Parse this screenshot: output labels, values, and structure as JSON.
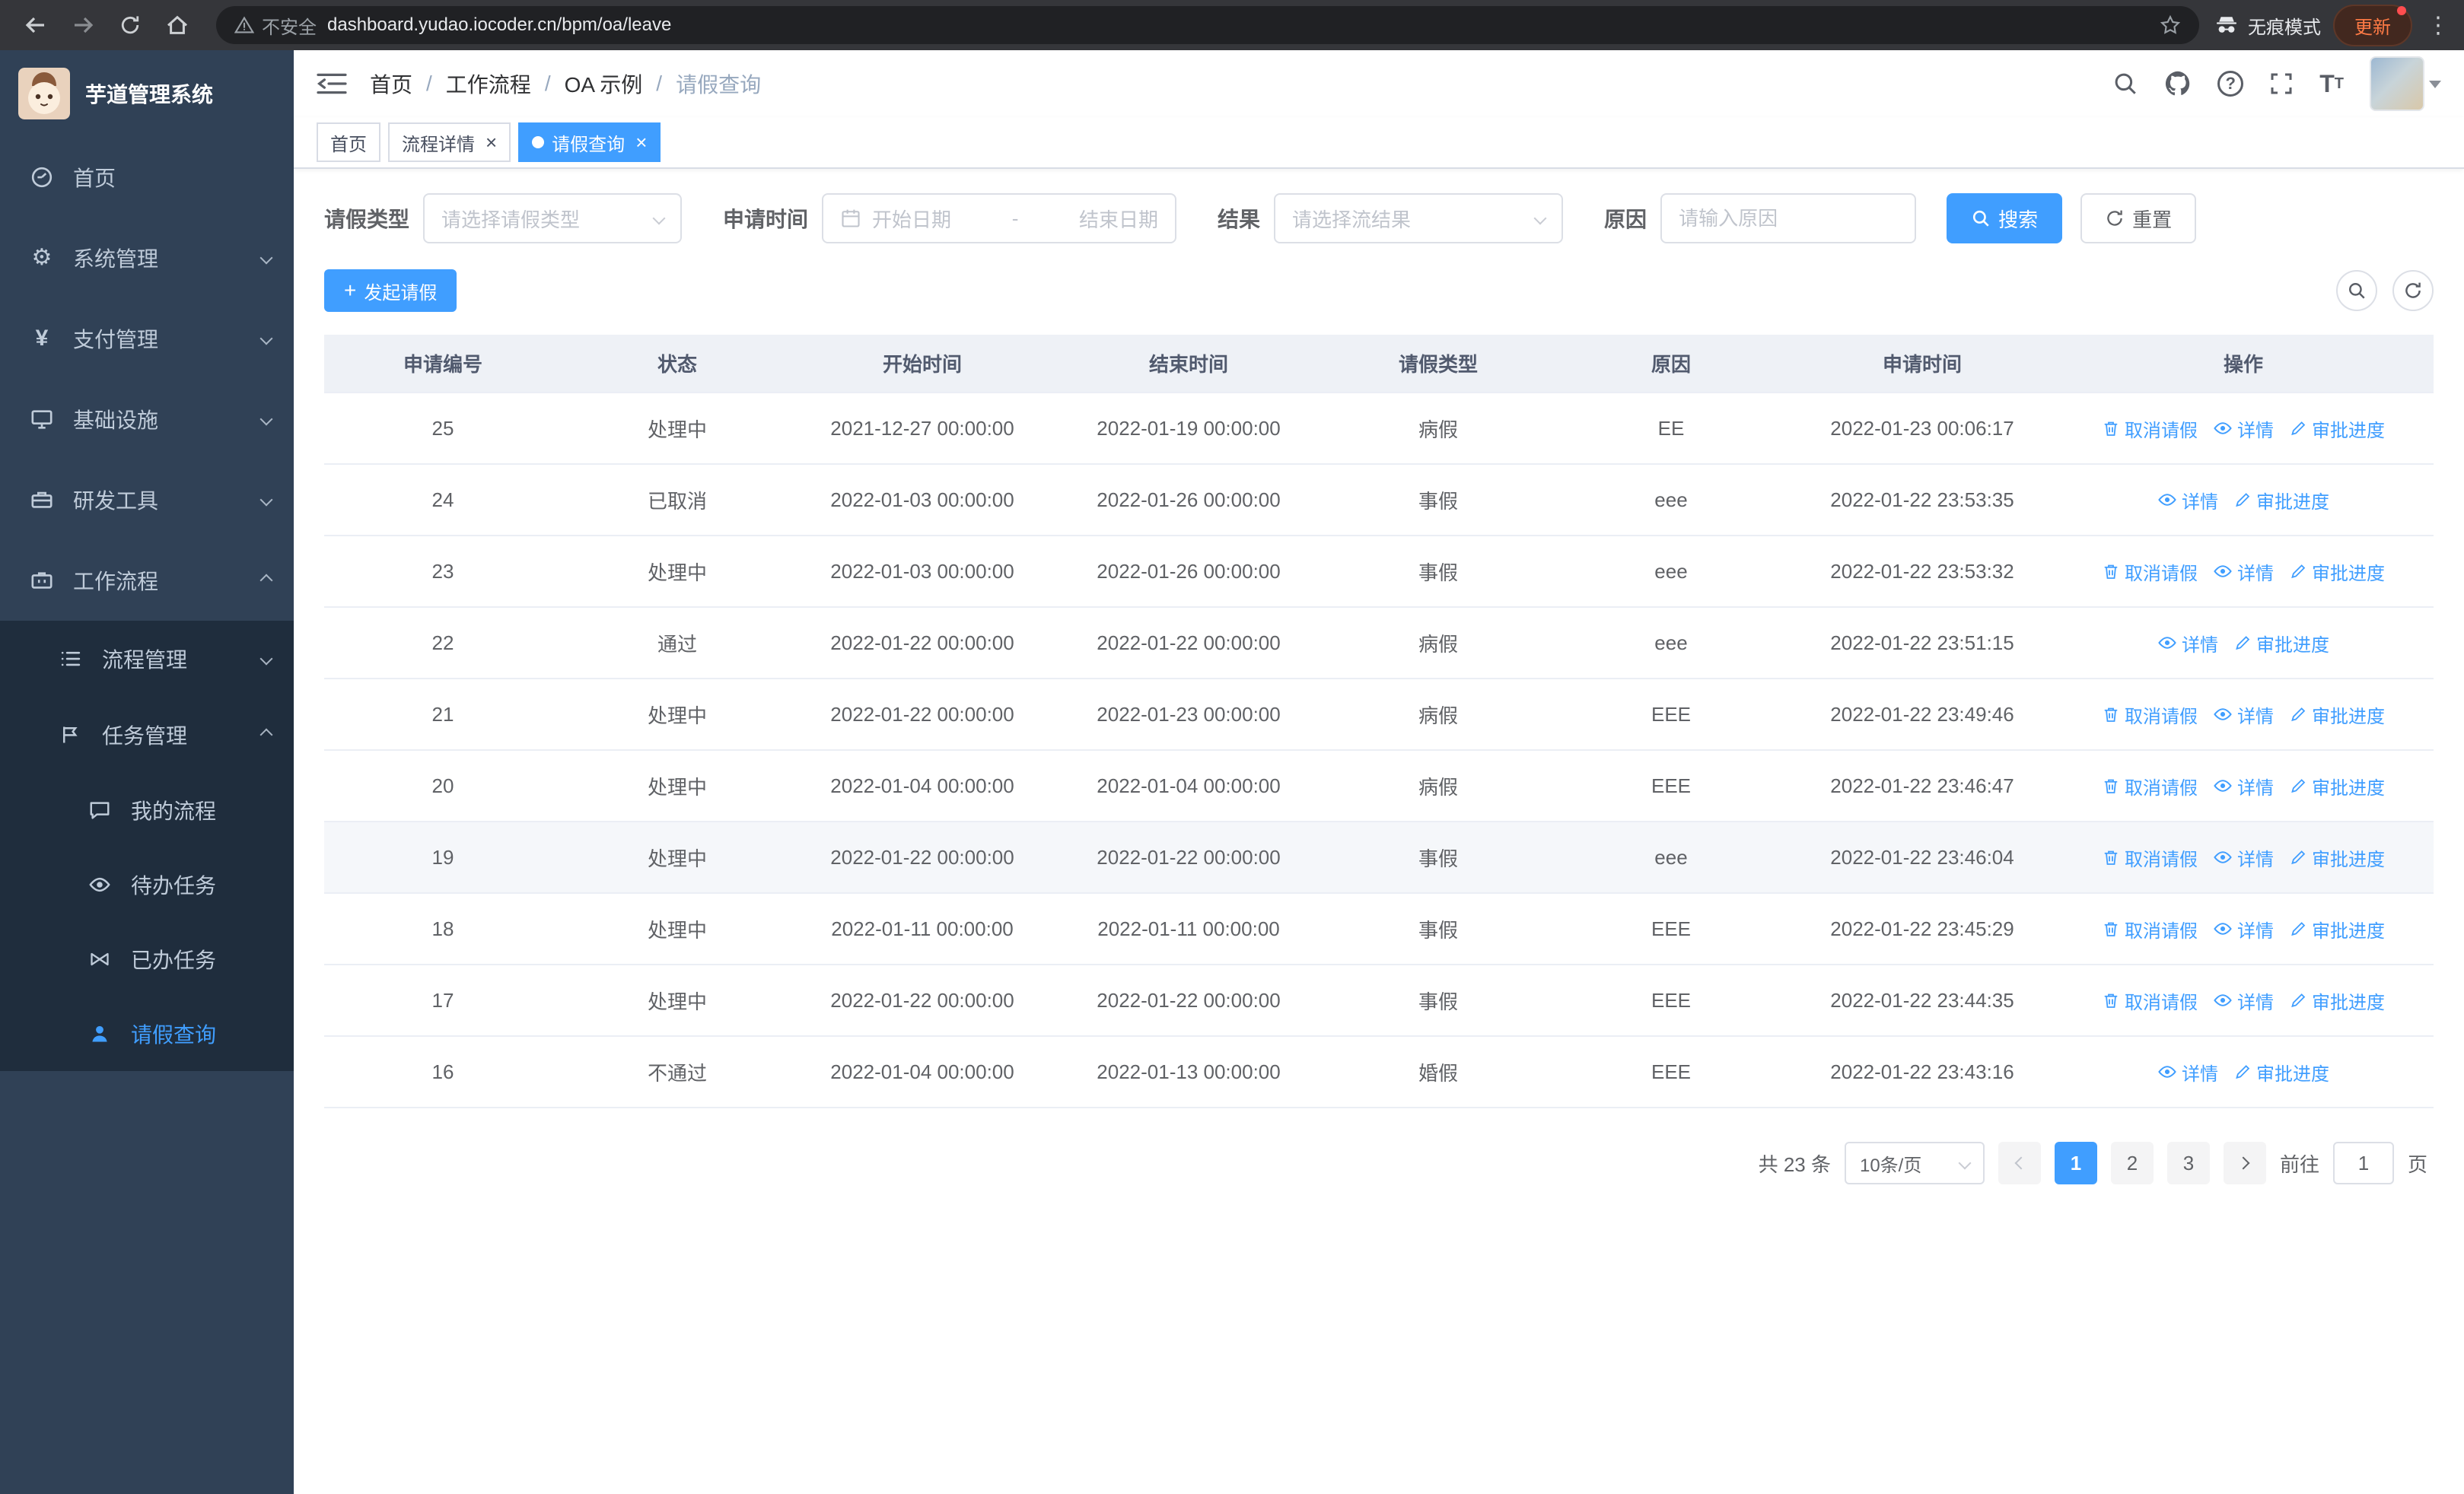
{
  "browser": {
    "security_label": "不安全",
    "url": "dashboard.yudao.iocoder.cn/bpm/oa/leave",
    "incognito_label": "无痕模式",
    "update_label": "更新"
  },
  "sidebar": {
    "logo_title": "芋道管理系统",
    "menu": [
      {
        "label": "首页"
      },
      {
        "label": "系统管理"
      },
      {
        "label": "支付管理"
      },
      {
        "label": "基础设施"
      },
      {
        "label": "研发工具"
      },
      {
        "label": "工作流程"
      }
    ],
    "workflow_children": [
      {
        "label": "流程管理"
      },
      {
        "label": "任务管理"
      }
    ],
    "task_children": [
      {
        "label": "我的流程"
      },
      {
        "label": "待办任务"
      },
      {
        "label": "已办任务"
      },
      {
        "label": "请假查询"
      }
    ]
  },
  "header": {
    "breadcrumbs": [
      "首页",
      "工作流程",
      "OA 示例",
      "请假查询"
    ]
  },
  "tabs": [
    {
      "label": "首页"
    },
    {
      "label": "流程详情"
    },
    {
      "label": "请假查询"
    }
  ],
  "filters": {
    "leave_type_label": "请假类型",
    "leave_type_placeholder": "请选择请假类型",
    "apply_time_label": "申请时间",
    "start_date_placeholder": "开始日期",
    "range_separator": "-",
    "end_date_placeholder": "结束日期",
    "result_label": "结果",
    "result_placeholder": "请选择流结果",
    "reason_label": "原因",
    "reason_placeholder": "请输入原因",
    "search_button": "搜索",
    "reset_button": "重置"
  },
  "toolbar": {
    "create_button": "发起请假"
  },
  "table": {
    "columns": [
      "申请编号",
      "状态",
      "开始时间",
      "结束时间",
      "请假类型",
      "原因",
      "申请时间",
      "操作"
    ],
    "rows": [
      {
        "id": "25",
        "status": "处理中",
        "start": "2021-12-27 00:00:00",
        "end": "2022-01-19 00:00:00",
        "type": "病假",
        "reason": "EE",
        "applied": "2022-01-23 00:06:17",
        "actions": [
          "取消请假",
          "详情",
          "审批进度"
        ]
      },
      {
        "id": "24",
        "status": "已取消",
        "start": "2022-01-03 00:00:00",
        "end": "2022-01-26 00:00:00",
        "type": "事假",
        "reason": "eee",
        "applied": "2022-01-22 23:53:35",
        "actions": [
          "详情",
          "审批进度"
        ]
      },
      {
        "id": "23",
        "status": "处理中",
        "start": "2022-01-03 00:00:00",
        "end": "2022-01-26 00:00:00",
        "type": "事假",
        "reason": "eee",
        "applied": "2022-01-22 23:53:32",
        "actions": [
          "取消请假",
          "详情",
          "审批进度"
        ]
      },
      {
        "id": "22",
        "status": "通过",
        "start": "2022-01-22 00:00:00",
        "end": "2022-01-22 00:00:00",
        "type": "病假",
        "reason": "eee",
        "applied": "2022-01-22 23:51:15",
        "actions": [
          "详情",
          "审批进度"
        ]
      },
      {
        "id": "21",
        "status": "处理中",
        "start": "2022-01-22 00:00:00",
        "end": "2022-01-23 00:00:00",
        "type": "病假",
        "reason": "EEE",
        "applied": "2022-01-22 23:49:46",
        "actions": [
          "取消请假",
          "详情",
          "审批进度"
        ]
      },
      {
        "id": "20",
        "status": "处理中",
        "start": "2022-01-04 00:00:00",
        "end": "2022-01-04 00:00:00",
        "type": "病假",
        "reason": "EEE",
        "applied": "2022-01-22 23:46:47",
        "actions": [
          "取消请假",
          "详情",
          "审批进度"
        ]
      },
      {
        "id": "19",
        "status": "处理中",
        "start": "2022-01-22 00:00:00",
        "end": "2022-01-22 00:00:00",
        "type": "事假",
        "reason": "eee",
        "applied": "2022-01-22 23:46:04",
        "actions": [
          "取消请假",
          "详情",
          "审批进度"
        ]
      },
      {
        "id": "18",
        "status": "处理中",
        "start": "2022-01-11 00:00:00",
        "end": "2022-01-11 00:00:00",
        "type": "事假",
        "reason": "EEE",
        "applied": "2022-01-22 23:45:29",
        "actions": [
          "取消请假",
          "详情",
          "审批进度"
        ]
      },
      {
        "id": "17",
        "status": "处理中",
        "start": "2022-01-22 00:00:00",
        "end": "2022-01-22 00:00:00",
        "type": "事假",
        "reason": "EEE",
        "applied": "2022-01-22 23:44:35",
        "actions": [
          "取消请假",
          "详情",
          "审批进度"
        ]
      },
      {
        "id": "16",
        "status": "不通过",
        "start": "2022-01-04 00:00:00",
        "end": "2022-01-13 00:00:00",
        "type": "婚假",
        "reason": "EEE",
        "applied": "2022-01-22 23:43:16",
        "actions": [
          "详情",
          "审批进度"
        ]
      }
    ]
  },
  "pagination": {
    "total": "共 23 条",
    "page_size": "10条/页",
    "pages": [
      "1",
      "2",
      "3"
    ],
    "active_page": "1",
    "goto_label": "前往",
    "goto_value": "1",
    "goto_suffix": "页"
  },
  "colors": {
    "primary": "#409eff",
    "sidebar_bg": "#304156",
    "submenu_bg": "#1f2d3d"
  }
}
